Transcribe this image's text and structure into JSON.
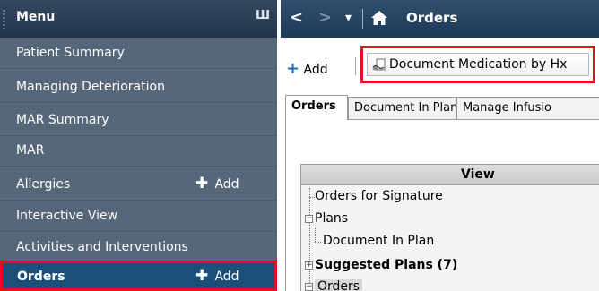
{
  "menu": {
    "title": "Menu",
    "pin_glyph": "Ш",
    "items": [
      {
        "label": "Patient Summary"
      },
      {
        "label": "Managing Deterioration"
      },
      {
        "label": "MAR Summary"
      },
      {
        "label": "MAR"
      },
      {
        "label": "Allergies",
        "add_label": "Add"
      },
      {
        "label": "Interactive View"
      },
      {
        "label": "Activities and Interventions"
      },
      {
        "label": "Orders",
        "add_label": "Add",
        "selected": true
      }
    ]
  },
  "header": {
    "title": "Orders",
    "back_glyph": "<",
    "forward_glyph": ">",
    "dropdown_glyph": "▾"
  },
  "toolbar": {
    "add_label": "Add",
    "document_med_label": "Document Medication by Hx"
  },
  "tabs": [
    {
      "label": "Orders",
      "active": true
    },
    {
      "label": "Document In Plan"
    },
    {
      "label": "Manage Infusio"
    }
  ],
  "view": {
    "header": "View",
    "rows": [
      {
        "label": "Orders for Signature"
      },
      {
        "label": "Plans",
        "expander": "−"
      },
      {
        "label": "Document In Plan"
      },
      {
        "label": "Suggested Plans (7)",
        "expander": "+"
      },
      {
        "label": "Orders",
        "expander": "−"
      }
    ]
  },
  "colors": {
    "menu_bg": "#566779",
    "menu_header_bg": "#2b4259",
    "selected_bg": "#1b4f78",
    "highlight_border": "#e60f1e",
    "add_plus": "#1a6fc2"
  }
}
